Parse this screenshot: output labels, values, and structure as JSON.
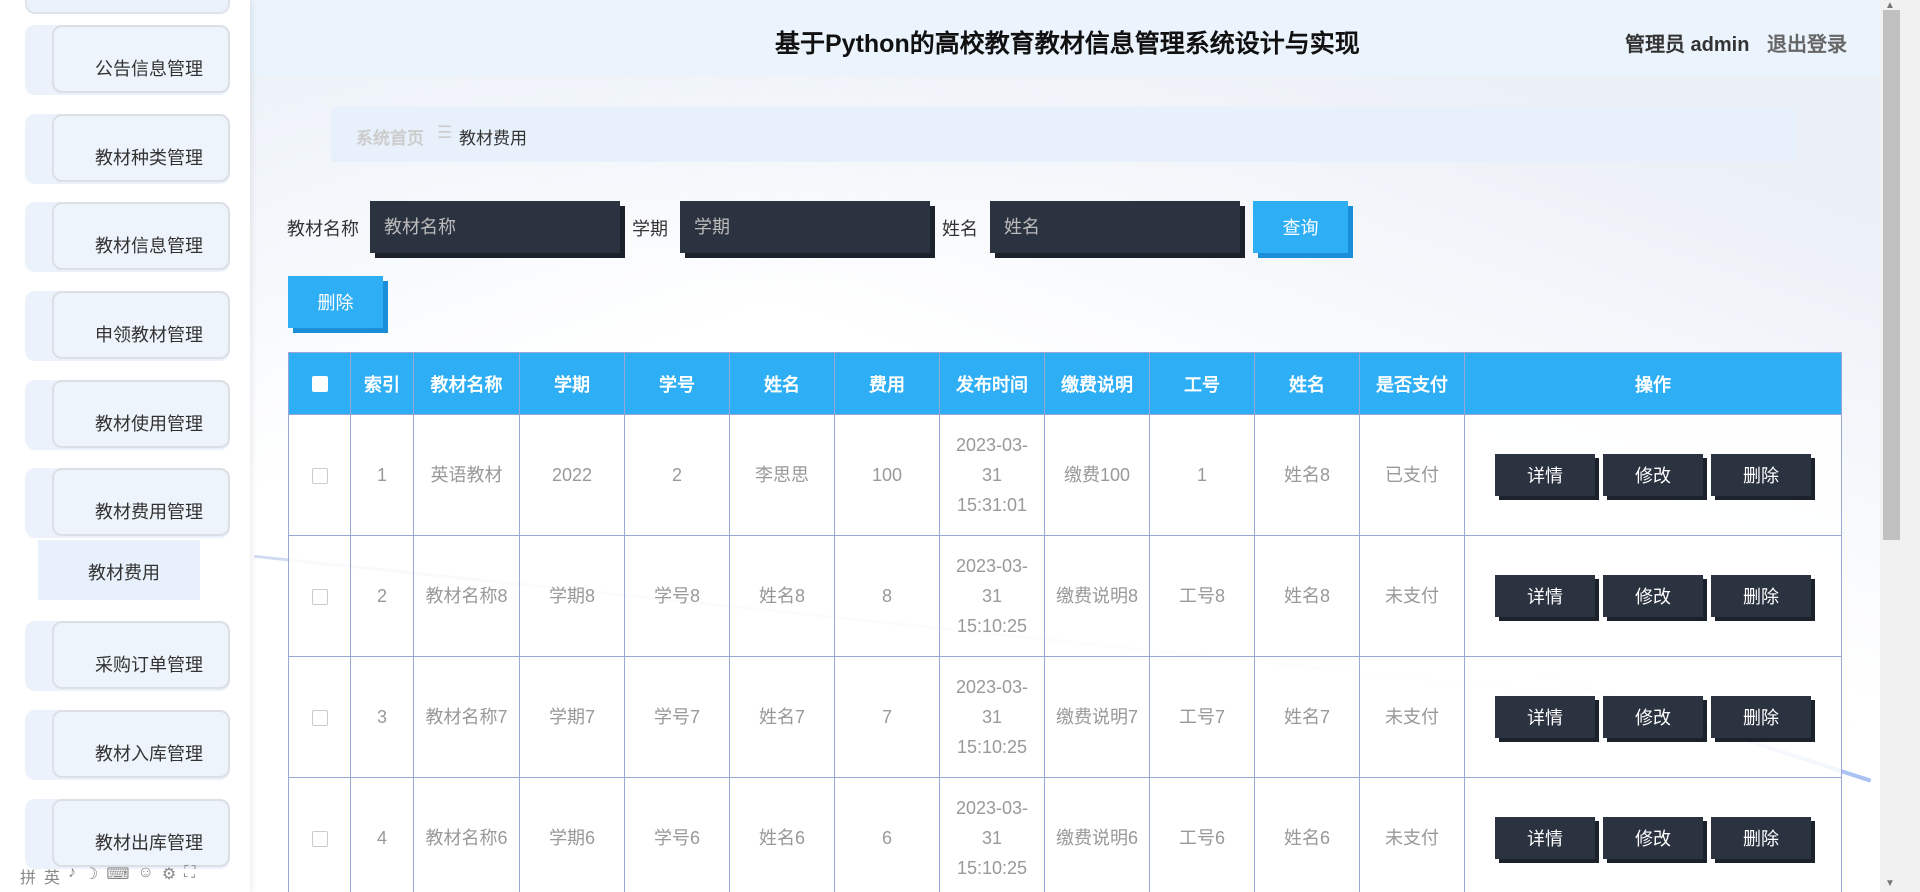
{
  "header": {
    "title": "基于Python的高校教育教材信息管理系统设计与实现",
    "admin_label": "管理员 admin",
    "logout_label": "退出登录"
  },
  "sidebar": {
    "items": [
      {
        "label": "公告信息管理"
      },
      {
        "label": "教材种类管理"
      },
      {
        "label": "教材信息管理"
      },
      {
        "label": "申领教材管理"
      },
      {
        "label": "教材使用管理"
      },
      {
        "label": "教材费用管理"
      },
      {
        "label": "采购订单管理"
      },
      {
        "label": "教材入库管理"
      },
      {
        "label": "教材出库管理"
      }
    ],
    "sub_item": {
      "label": "教材费用"
    },
    "ime_glyphs": [
      "拼",
      "英",
      "♪",
      "☽",
      "⌨",
      "☺",
      "⚙",
      "⛶"
    ]
  },
  "breadcrumb": {
    "home": "系统首页",
    "separator": "☰",
    "current": "教材费用"
  },
  "search": {
    "fields": [
      {
        "label": "教材名称",
        "placeholder": "教材名称"
      },
      {
        "label": "学期",
        "placeholder": "学期"
      },
      {
        "label": "姓名",
        "placeholder": "姓名"
      }
    ],
    "query_button": "查询",
    "delete_button": "删除"
  },
  "table": {
    "columns": [
      "索引",
      "教材名称",
      "学期",
      "学号",
      "姓名",
      "费用",
      "发布时间",
      "缴费说明",
      "工号",
      "姓名",
      "是否支付",
      "操作"
    ],
    "rows": [
      [
        "1",
        "英语教材",
        "2022",
        "2",
        "李思思",
        "100",
        "2023-03-31 15:31:01",
        "缴费100",
        "1",
        "姓名8",
        "已支付"
      ],
      [
        "2",
        "教材名称8",
        "学期8",
        "学号8",
        "姓名8",
        "8",
        "2023-03-31 15:10:25",
        "缴费说明8",
        "工号8",
        "姓名8",
        "未支付"
      ],
      [
        "3",
        "教材名称7",
        "学期7",
        "学号7",
        "姓名7",
        "7",
        "2023-03-31 15:10:25",
        "缴费说明7",
        "工号7",
        "姓名7",
        "未支付"
      ],
      [
        "4",
        "教材名称6",
        "学期6",
        "学号6",
        "姓名6",
        "6",
        "2023-03-31 15:10:25",
        "缴费说明6",
        "工号6",
        "姓名6",
        "未支付"
      ]
    ],
    "row_actions": [
      "详情",
      "修改",
      "删除"
    ]
  },
  "colors": {
    "accent": "#2eaef5",
    "dark_button": "#2c3340",
    "header_bg": "#ebf3fc"
  }
}
